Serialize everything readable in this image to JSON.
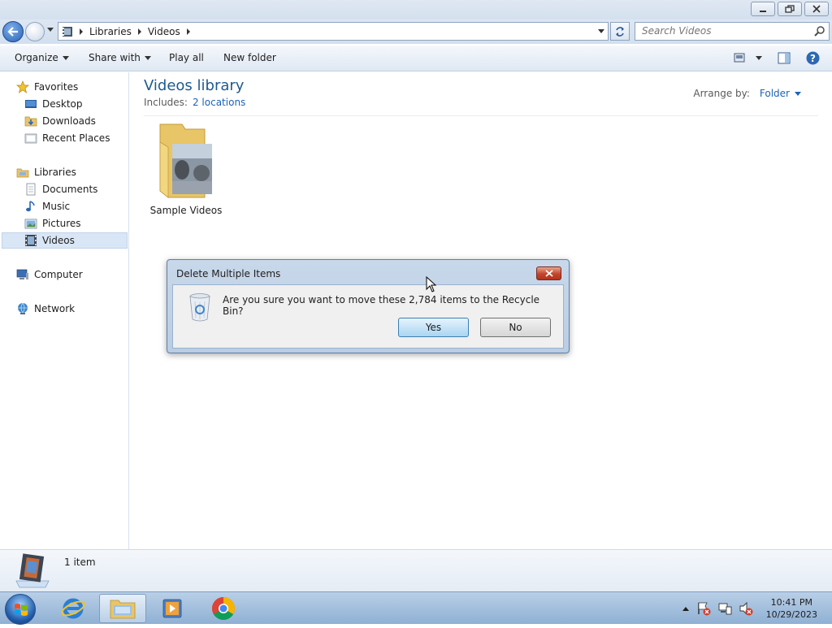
{
  "window": {
    "breadcrumb": [
      "Libraries",
      "Videos"
    ],
    "search_placeholder": "Search Videos"
  },
  "toolbar": {
    "organize": "Organize",
    "share_with": "Share with",
    "play_all": "Play all",
    "new_folder": "New folder"
  },
  "nav": {
    "favorites": "Favorites",
    "desktop": "Desktop",
    "downloads": "Downloads",
    "recent_places": "Recent Places",
    "libraries": "Libraries",
    "documents": "Documents",
    "music": "Music",
    "pictures": "Pictures",
    "videos": "Videos",
    "computer": "Computer",
    "network": "Network"
  },
  "content": {
    "title": "Videos library",
    "includes_label": "Includes:",
    "includes_link": "2 locations",
    "arrange_label": "Arrange by:",
    "arrange_value": "Folder",
    "folder_name": "Sample Videos"
  },
  "details": {
    "count": "1 item"
  },
  "dialog": {
    "title": "Delete Multiple Items",
    "message": "Are you sure you want to move these 2,784 items to the Recycle Bin?",
    "yes": "Yes",
    "no": "No"
  },
  "taskbar": {
    "time": "10:41 PM",
    "date": "10/29/2023"
  },
  "colors": {
    "accent_blue": "#1c63b6",
    "title_blue": "#1e5a8f",
    "close_red": "#c2452d"
  }
}
